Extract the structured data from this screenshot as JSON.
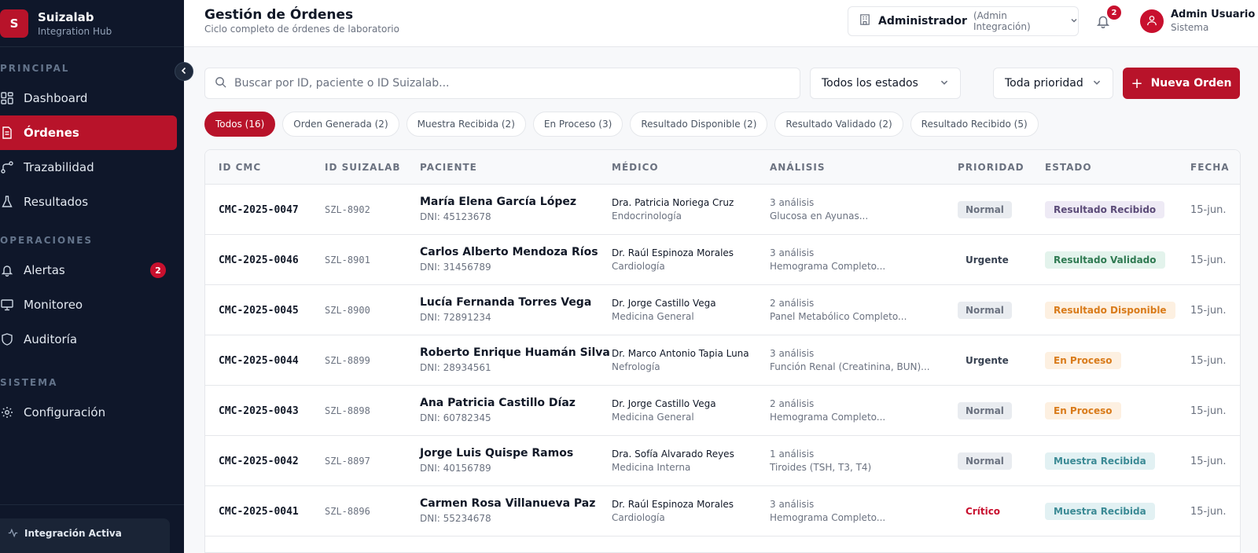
{
  "brand": {
    "logo_letter": "S",
    "name": "Suizalab",
    "subtitle": "Integration Hub"
  },
  "sidebar": {
    "sections": [
      {
        "label": "PRINCIPAL"
      },
      {
        "label": "OPERACIONES"
      },
      {
        "label": "SISTEMA"
      }
    ],
    "items": [
      {
        "label": "Dashboard",
        "icon": "dashboard-icon"
      },
      {
        "label": "Órdenes",
        "icon": "document-icon",
        "active": true
      },
      {
        "label": "Trazabilidad",
        "icon": "route-icon"
      },
      {
        "label": "Resultados",
        "icon": "flask-icon"
      },
      {
        "label": "Alertas",
        "icon": "bell-icon",
        "badge": "2"
      },
      {
        "label": "Monitoreo",
        "icon": "monitor-icon"
      },
      {
        "label": "Auditoría",
        "icon": "shield-icon"
      },
      {
        "label": "Configuración",
        "icon": "gear-icon"
      }
    ],
    "integration": {
      "label": "Integración Activa",
      "icon": "activity-icon"
    }
  },
  "header": {
    "title": "Gestión de Órdenes",
    "subtitle": "Ciclo completo de órdenes de laboratorio",
    "role": {
      "name": "Administrador",
      "detail": "(Admin Integración)"
    },
    "notifications": "2",
    "user": {
      "name": "Admin Usuario",
      "role": "Sistema"
    }
  },
  "toolbar": {
    "search_placeholder": "Buscar por ID, paciente o ID Suizalab...",
    "status_filter": "Todos los estados",
    "priority_filter": "Toda prioridad",
    "new_button": "Nueva Orden"
  },
  "chips": [
    {
      "label": "Todos (16)",
      "active": true
    },
    {
      "label": "Orden Generada (2)"
    },
    {
      "label": "Muestra Recibida (2)"
    },
    {
      "label": "En Proceso (3)"
    },
    {
      "label": "Resultado Disponible (2)"
    },
    {
      "label": "Resultado Validado (2)"
    },
    {
      "label": "Resultado Recibido (5)"
    }
  ],
  "table": {
    "headers": [
      "ID CMC",
      "ID SUIZALAB",
      "PACIENTE",
      "MÉDICO",
      "ANÁLISIS",
      "PRIORIDAD",
      "ESTADO",
      "FECHA"
    ],
    "rows": [
      {
        "cmc": "CMC-2025-0047",
        "szl": "SZL-8902",
        "patient": "María Elena García López",
        "dni": "DNI: 45123678",
        "doctor": "Dra. Patricia Noriega Cruz",
        "specialty": "Endocrinología",
        "analysis_count": "3 análisis",
        "analysis": "Glucosa en Ayunas...",
        "priority": "Normal",
        "status": "Resultado Recibido",
        "date": "15-jun."
      },
      {
        "cmc": "CMC-2025-0046",
        "szl": "SZL-8901",
        "patient": "Carlos Alberto Mendoza Ríos",
        "dni": "DNI: 31456789",
        "doctor": "Dr. Raúl Espinoza Morales",
        "specialty": "Cardiología",
        "analysis_count": "3 análisis",
        "analysis": "Hemograma Completo...",
        "priority": "Urgente",
        "status": "Resultado Validado",
        "date": "15-jun."
      },
      {
        "cmc": "CMC-2025-0045",
        "szl": "SZL-8900",
        "patient": "Lucía Fernanda Torres Vega",
        "dni": "DNI: 72891234",
        "doctor": "Dr. Jorge Castillo Vega",
        "specialty": "Medicina General",
        "analysis_count": "2 análisis",
        "analysis": "Panel Metabólico Completo...",
        "priority": "Normal",
        "status": "Resultado Disponible",
        "date": "15-jun."
      },
      {
        "cmc": "CMC-2025-0044",
        "szl": "SZL-8899",
        "patient": "Roberto Enrique Huamán Silva",
        "dni": "DNI: 28934561",
        "doctor": "Dr. Marco Antonio Tapia Luna",
        "specialty": "Nefrología",
        "analysis_count": "3 análisis",
        "analysis": "Función Renal (Creatinina, BUN)...",
        "priority": "Urgente",
        "status": "En Proceso",
        "date": "15-jun."
      },
      {
        "cmc": "CMC-2025-0043",
        "szl": "SZL-8898",
        "patient": "Ana Patricia Castillo Díaz",
        "dni": "DNI: 60782345",
        "doctor": "Dr. Jorge Castillo Vega",
        "specialty": "Medicina General",
        "analysis_count": "2 análisis",
        "analysis": "Hemograma Completo...",
        "priority": "Normal",
        "status": "En Proceso",
        "date": "15-jun."
      },
      {
        "cmc": "CMC-2025-0042",
        "szl": "SZL-8897",
        "patient": "Jorge Luis Quispe Ramos",
        "dni": "DNI: 40156789",
        "doctor": "Dra. Sofía Alvarado Reyes",
        "specialty": "Medicina Interna",
        "analysis_count": "1 análisis",
        "analysis": "Tiroides (TSH, T3, T4)",
        "priority": "Normal",
        "status": "Muestra Recibida",
        "date": "15-jun."
      },
      {
        "cmc": "CMC-2025-0041",
        "szl": "SZL-8896",
        "patient": "Carmen Rosa Villanueva Paz",
        "dni": "DNI: 55234678",
        "doctor": "Dr. Raúl Espinoza Morales",
        "specialty": "Cardiología",
        "analysis_count": "3 análisis",
        "analysis": "Hemograma Completo...",
        "priority": "Crítico",
        "status": "Muestra Recibida",
        "date": "15-jun."
      }
    ]
  },
  "colors": {
    "brand_red": "#b8132a",
    "sidebar_bg": "#0f172a"
  }
}
